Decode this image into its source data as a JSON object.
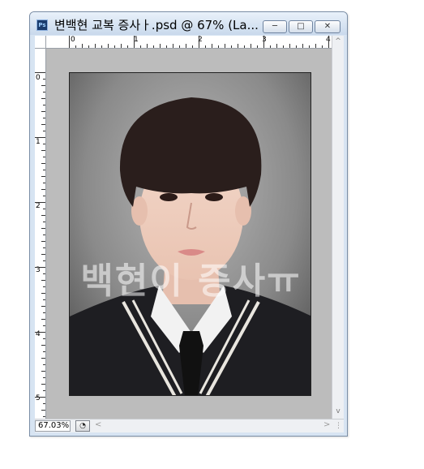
{
  "window": {
    "title": "변백현 교복 증사ㅏ.psd @ 67% (La...",
    "app_icon": "Ps",
    "buttons": {
      "minimize": "minimize-icon",
      "maximize": "maximize-icon",
      "close": "close-icon"
    }
  },
  "rulers": {
    "horizontal_labels": [
      "0",
      "1",
      "2",
      "3",
      "4"
    ],
    "vertical_labels": [
      "0",
      "1",
      "2",
      "3",
      "4",
      "5"
    ]
  },
  "document": {
    "watermark_text": "백현이 증사ㅠ"
  },
  "status": {
    "zoom": "67.03%",
    "left_arrow": "<",
    "right_arrow": ">",
    "up_arrow": "^",
    "down_arrow": "v"
  },
  "colors": {
    "canvas_gray": "#bcbcbc",
    "titlebar_blue": "#d7e4f2",
    "close_hover": "#c9302c"
  }
}
